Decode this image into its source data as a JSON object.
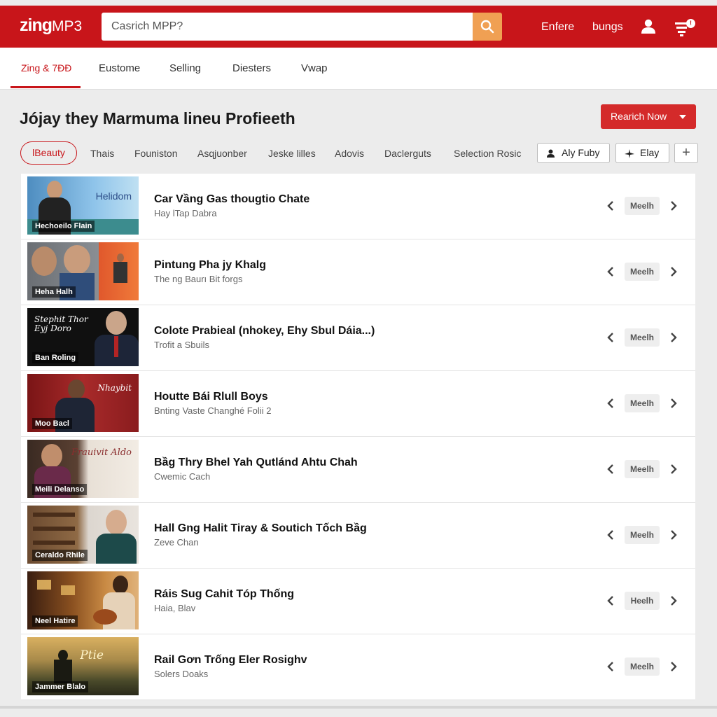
{
  "app": {
    "logo_main": "zing",
    "logo_suffix": "MP3",
    "search_placeholder": "Casrich MPP?",
    "top_links": [
      "Enfere",
      "bungs"
    ],
    "accent_color": "#c8151a",
    "icons": {
      "search": "search-icon",
      "user": "user-icon",
      "queue": "queue-icon"
    }
  },
  "nav": {
    "tabs": [
      "Zing & 7ĐĐ",
      "Eustome",
      "Selling",
      "Diesters",
      "Vwap"
    ],
    "active_index": 0
  },
  "page": {
    "title": "Jójay they Marmuma lineu Profieeth",
    "primary_button": "Rearich Now"
  },
  "filters": {
    "chips": [
      "lBeauty",
      "Thais",
      "Founiston",
      "Asqjuonber",
      "Jeske lilles",
      "Adovis",
      "Daclerguts",
      "Selection Rosic"
    ],
    "active_index": 0,
    "action_buttons": [
      {
        "label": "Aly Fuby",
        "icon": "user-icon"
      },
      {
        "label": "Elay",
        "icon": "plane-icon"
      }
    ],
    "add_button": "+"
  },
  "tracks": [
    {
      "title": "Car Vầng Gas thougtio Chate",
      "subtitle": "Hay lTap Dabra",
      "action": "Meelh",
      "thumb_caption": "Hechoeilo Flain",
      "thumb_text": "Helidom"
    },
    {
      "title": "Pintung Pha jy Khalg",
      "subtitle": "The ng Baurı Bit forgs",
      "action": "Meelh",
      "thumb_caption": "Heha Halh",
      "thumb_text": ""
    },
    {
      "title": "Colote Prabieal (nhokey, Ehy Sbul Dáia...)",
      "subtitle": "Trofit a Sbuils",
      "action": "Meelh",
      "thumb_caption": "Ban Roling",
      "thumb_text": "Stephit Thor Eyj Doro"
    },
    {
      "title": "Houtte Bái Rlull Boys",
      "subtitle": "Bnting Vaste Changhé Folii 2",
      "action": "Meelh",
      "thumb_caption": "Moo Bacl",
      "thumb_text": "Nhaybit"
    },
    {
      "title": "Bầg Thry Bhel Yah Qutlánd Ahtu Chah",
      "subtitle": "Cwemic Cach",
      "action": "Meelh",
      "thumb_caption": "Meili Delanso",
      "thumb_text": "Frauivit Aldo"
    },
    {
      "title": "Hall Gng Halit Tiray & Soutich Tốch Bầg",
      "subtitle": "Zeve Chan",
      "action": "Meelh",
      "thumb_caption": "Ceraldo Rhile",
      "thumb_text": ""
    },
    {
      "title": "Ráis Sug Cahit Tóp Thống",
      "subtitle": "Haia, Blav",
      "action": "Heelh",
      "thumb_caption": "Neel Hatire",
      "thumb_text": ""
    },
    {
      "title": "Rail Gơn Trống Eler Rosighv",
      "subtitle": "Solers Doaks",
      "action": "Meelh",
      "thumb_caption": "Jammer Blalo",
      "thumb_text": "Ptie"
    }
  ]
}
